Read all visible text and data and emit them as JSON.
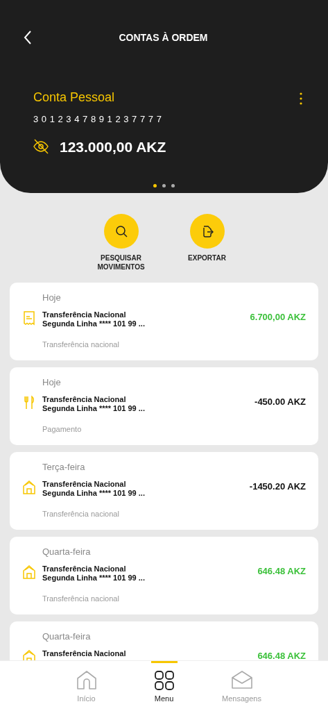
{
  "header": {
    "title": "CONTAS À ORDEM",
    "account_name": "Conta Pessoal",
    "account_number": "3 0 1 2 3 4 7 8 9 1 2 3 7 7 7 7",
    "balance": "123.000,00 AKZ",
    "pages": [
      {
        "selected": true
      },
      {
        "selected": false
      },
      {
        "selected": false
      }
    ]
  },
  "actions": [
    {
      "kind": "search",
      "label": "PESQUISAR MOVIMENTOS"
    },
    {
      "kind": "export",
      "label": "EXPORTAR"
    }
  ],
  "transactions": [
    {
      "kind": "receipt",
      "date": "Hoje",
      "title": "Transferência Nacional",
      "detail": "Segunda Linha **** 101 99 ...",
      "amount": "6.700,00 AKZ",
      "credit": true,
      "category": "Transferência nacional"
    },
    {
      "kind": "cutlery",
      "date": "Hoje",
      "title": "Transferência Nacional",
      "detail": "Segunda Linha **** 101 99 ...",
      "amount": "-450.00 AKZ",
      "credit": false,
      "category": "Pagamento"
    },
    {
      "kind": "house",
      "date": "Terça-feira",
      "title": "Transferência Nacional",
      "detail": "Segunda Linha **** 101 99 ...",
      "amount": "-1450.20 AKZ",
      "credit": false,
      "category": "Transferência nacional"
    },
    {
      "kind": "house",
      "date": "Quarta-feira",
      "title": "Transferência Nacional",
      "detail": "Segunda Linha **** 101 99 ...",
      "amount": "646.48 AKZ",
      "credit": true,
      "category": "Transferência nacional"
    },
    {
      "kind": "house",
      "date": "Quarta-feira",
      "title": "Transferência Nacional",
      "amount": "646.48 AKZ",
      "credit": true
    }
  ],
  "nav": [
    {
      "kind": "home",
      "label": "Início",
      "selected": false
    },
    {
      "kind": "menu",
      "label": "Menu",
      "selected": true
    },
    {
      "kind": "mail",
      "label": "Mensagens",
      "selected": false
    }
  ]
}
